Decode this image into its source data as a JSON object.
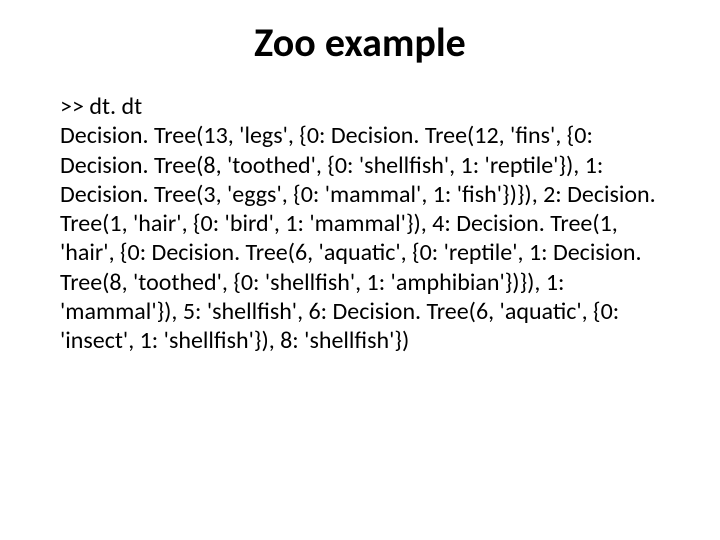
{
  "title": "Zoo example",
  "prompt": ">> dt. dt",
  "code": "Decision. Tree(13, 'legs', {0: Decision. Tree(12, 'fins', {0: Decision. Tree(8, 'toothed', {0: 'shellfish', 1: 'reptile'}), 1: Decision. Tree(3, 'eggs', {0: 'mammal', 1: 'fish'})}), 2: Decision. Tree(1, 'hair', {0: 'bird', 1: 'mammal'}), 4: Decision. Tree(1, 'hair', {0: Decision. Tree(6, 'aquatic', {0: 'reptile', 1: Decision. Tree(8, 'toothed', {0: 'shellfish', 1: 'amphibian'})}), 1: 'mammal'}), 5: 'shellfish', 6: Decision. Tree(6, 'aquatic', {0: 'insect', 1: 'shellfish'}), 8: 'shellfish'})"
}
